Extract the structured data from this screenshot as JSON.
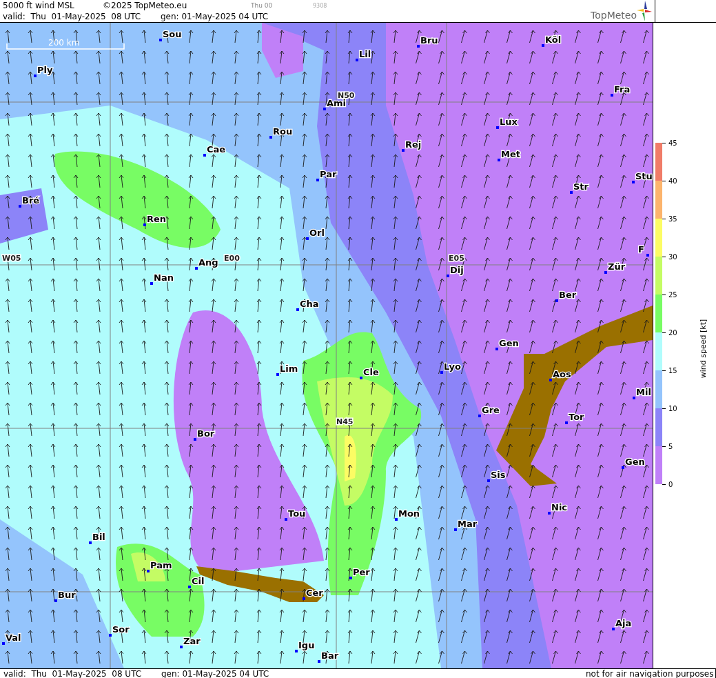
{
  "header": {
    "title": "5000 ft wind MSL",
    "copyright": "©2025 TopMeteo.eu",
    "run": "Thu 00",
    "code": "9308",
    "valid": "valid:  Thu  01-May-2025  08 UTC",
    "generated": "gen: 01-May-2025 04 UTC"
  },
  "logo": {
    "text": "TopMeteo"
  },
  "map": {
    "scale": "200 km",
    "grid_labels": [
      "N50",
      "W05",
      "E00",
      "E05",
      "N45"
    ],
    "cities": [
      "Sou",
      "Lil",
      "Bru",
      "Köl",
      "Ply",
      "Ami",
      "Fra",
      "Lux",
      "Rou",
      "Rej",
      "Cae",
      "Met",
      "Par",
      "Stu",
      "Bré",
      "Str",
      "Ren",
      "Orl",
      "Ang",
      "Nan",
      "Dij",
      "Zür",
      "Ber",
      "Cha",
      "Gen",
      "Lim",
      "Cle",
      "Lyo",
      "Aos",
      "Mil",
      "Gre",
      "Tor",
      "Bor",
      "Gen",
      "Sis",
      "Nic",
      "Tou",
      "Mon",
      "Mar",
      "Bil",
      "Pam",
      "Per",
      "Cil",
      "Cer",
      "Bur",
      "Sor",
      "Val",
      "Aja",
      "Zar",
      "Igu",
      "Bar",
      "F"
    ]
  },
  "legend": {
    "title": "wind speed [kt]",
    "ticks": [
      "45",
      "40",
      "35",
      "30",
      "25",
      "20",
      "15",
      "10",
      "5",
      "0"
    ],
    "bands": [
      {
        "color": "#f07c68"
      },
      {
        "color": "#fcb46c"
      },
      {
        "color": "#fcfc64"
      },
      {
        "color": "#c4fc64"
      },
      {
        "color": "#78fc64"
      },
      {
        "color": "#b0fcfc"
      },
      {
        "color": "#94c4fc"
      },
      {
        "color": "#8c84f8"
      },
      {
        "color": "#c080f8"
      }
    ]
  },
  "footer": {
    "valid": "valid:  Thu  01-May-2025  08 UTC",
    "generated": "gen: 01-May-2025 04 UTC",
    "disclaimer": "not for air navigation purposes"
  }
}
